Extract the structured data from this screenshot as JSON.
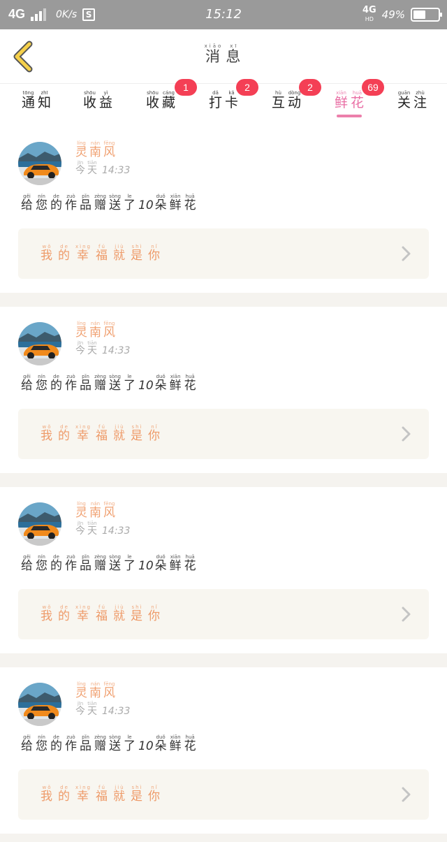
{
  "status_bar": {
    "network": "4G",
    "speed": "0K/s",
    "time": "15:12",
    "network_right": "4G",
    "network_right_sub": "HD",
    "battery_percent": "49%",
    "battery_level": 0.49
  },
  "header": {
    "title": [
      {
        "py": "xiāo",
        "ch": "消"
      },
      {
        "py": "xī",
        "ch": "息"
      }
    ]
  },
  "tabs": [
    {
      "label": [
        {
          "py": "tōng",
          "ch": "通"
        },
        {
          "py": "zhī",
          "ch": "知"
        }
      ],
      "badge": ""
    },
    {
      "label": [
        {
          "py": "shōu",
          "ch": "收"
        },
        {
          "py": "yì",
          "ch": "益"
        }
      ],
      "badge": ""
    },
    {
      "label": [
        {
          "py": "shōu",
          "ch": "收"
        },
        {
          "py": "cáng",
          "ch": "藏"
        }
      ],
      "badge": "1"
    },
    {
      "label": [
        {
          "py": "dǎ",
          "ch": "打"
        },
        {
          "py": "kǎ",
          "ch": "卡"
        }
      ],
      "badge": "2"
    },
    {
      "label": [
        {
          "py": "hù",
          "ch": "互"
        },
        {
          "py": "dòng",
          "ch": "动"
        }
      ],
      "badge": "2"
    },
    {
      "label": [
        {
          "py": "xiān",
          "ch": "鲜"
        },
        {
          "py": "huā",
          "ch": "花"
        }
      ],
      "badge": "69"
    },
    {
      "label": [
        {
          "py": "guān",
          "ch": "关"
        },
        {
          "py": "zhù",
          "ch": "注"
        }
      ],
      "badge": ""
    }
  ],
  "active_tab": 5,
  "messages": [
    {
      "user_name": [
        {
          "py": "líng",
          "ch": "灵"
        },
        {
          "py": "nán",
          "ch": "南"
        },
        {
          "py": "fēng",
          "ch": "风"
        }
      ],
      "date": [
        {
          "py": "jīn",
          "ch": "今"
        },
        {
          "py": "tiān",
          "ch": "天"
        }
      ],
      "time": "14:33",
      "text": [
        {
          "py": "gěi",
          "ch": "给"
        },
        {
          "py": "nín",
          "ch": "您"
        },
        {
          "py": "de",
          "ch": "的"
        },
        {
          "py": "zuò",
          "ch": "作"
        },
        {
          "py": "pǐn",
          "ch": "品"
        },
        {
          "py": "zèng",
          "ch": "赠"
        },
        {
          "py": "sòng",
          "ch": "送"
        },
        {
          "py": "le",
          "ch": "了"
        }
      ],
      "count": "10",
      "text_tail": [
        {
          "py": "duǒ",
          "ch": "朵"
        },
        {
          "py": "xiān",
          "ch": "鲜"
        },
        {
          "py": "huā",
          "ch": "花"
        }
      ],
      "work_title": [
        {
          "py": "wǒ",
          "ch": "我"
        },
        {
          "py": "de",
          "ch": "的"
        },
        {
          "py": "xìng",
          "ch": "幸"
        },
        {
          "py": "fú",
          "ch": "福"
        },
        {
          "py": "jiù",
          "ch": "就"
        },
        {
          "py": "shì",
          "ch": "是"
        },
        {
          "py": "nǐ",
          "ch": "你"
        }
      ]
    },
    {
      "user_name": [
        {
          "py": "líng",
          "ch": "灵"
        },
        {
          "py": "nán",
          "ch": "南"
        },
        {
          "py": "fēng",
          "ch": "风"
        }
      ],
      "date": [
        {
          "py": "jīn",
          "ch": "今"
        },
        {
          "py": "tiān",
          "ch": "天"
        }
      ],
      "time": "14:33",
      "text": [
        {
          "py": "gěi",
          "ch": "给"
        },
        {
          "py": "nín",
          "ch": "您"
        },
        {
          "py": "de",
          "ch": "的"
        },
        {
          "py": "zuò",
          "ch": "作"
        },
        {
          "py": "pǐn",
          "ch": "品"
        },
        {
          "py": "zèng",
          "ch": "赠"
        },
        {
          "py": "sòng",
          "ch": "送"
        },
        {
          "py": "le",
          "ch": "了"
        }
      ],
      "count": "10",
      "text_tail": [
        {
          "py": "duǒ",
          "ch": "朵"
        },
        {
          "py": "xiān",
          "ch": "鲜"
        },
        {
          "py": "huā",
          "ch": "花"
        }
      ],
      "work_title": [
        {
          "py": "wǒ",
          "ch": "我"
        },
        {
          "py": "de",
          "ch": "的"
        },
        {
          "py": "xìng",
          "ch": "幸"
        },
        {
          "py": "fú",
          "ch": "福"
        },
        {
          "py": "jiù",
          "ch": "就"
        },
        {
          "py": "shì",
          "ch": "是"
        },
        {
          "py": "nǐ",
          "ch": "你"
        }
      ]
    },
    {
      "user_name": [
        {
          "py": "líng",
          "ch": "灵"
        },
        {
          "py": "nán",
          "ch": "南"
        },
        {
          "py": "fēng",
          "ch": "风"
        }
      ],
      "date": [
        {
          "py": "jīn",
          "ch": "今"
        },
        {
          "py": "tiān",
          "ch": "天"
        }
      ],
      "time": "14:33",
      "text": [
        {
          "py": "gěi",
          "ch": "给"
        },
        {
          "py": "nín",
          "ch": "您"
        },
        {
          "py": "de",
          "ch": "的"
        },
        {
          "py": "zuò",
          "ch": "作"
        },
        {
          "py": "pǐn",
          "ch": "品"
        },
        {
          "py": "zèng",
          "ch": "赠"
        },
        {
          "py": "sòng",
          "ch": "送"
        },
        {
          "py": "le",
          "ch": "了"
        }
      ],
      "count": "10",
      "text_tail": [
        {
          "py": "duǒ",
          "ch": "朵"
        },
        {
          "py": "xiān",
          "ch": "鲜"
        },
        {
          "py": "huā",
          "ch": "花"
        }
      ],
      "work_title": [
        {
          "py": "wǒ",
          "ch": "我"
        },
        {
          "py": "de",
          "ch": "的"
        },
        {
          "py": "xìng",
          "ch": "幸"
        },
        {
          "py": "fú",
          "ch": "福"
        },
        {
          "py": "jiù",
          "ch": "就"
        },
        {
          "py": "shì",
          "ch": "是"
        },
        {
          "py": "nǐ",
          "ch": "你"
        }
      ]
    },
    {
      "user_name": [
        {
          "py": "líng",
          "ch": "灵"
        },
        {
          "py": "nán",
          "ch": "南"
        },
        {
          "py": "fēng",
          "ch": "风"
        }
      ],
      "date": [
        {
          "py": "jīn",
          "ch": "今"
        },
        {
          "py": "tiān",
          "ch": "天"
        }
      ],
      "time": "14:33",
      "text": [
        {
          "py": "gěi",
          "ch": "给"
        },
        {
          "py": "nín",
          "ch": "您"
        },
        {
          "py": "de",
          "ch": "的"
        },
        {
          "py": "zuò",
          "ch": "作"
        },
        {
          "py": "pǐn",
          "ch": "品"
        },
        {
          "py": "zèng",
          "ch": "赠"
        },
        {
          "py": "sòng",
          "ch": "送"
        },
        {
          "py": "le",
          "ch": "了"
        }
      ],
      "count": "10",
      "text_tail": [
        {
          "py": "duǒ",
          "ch": "朵"
        },
        {
          "py": "xiān",
          "ch": "鲜"
        },
        {
          "py": "huā",
          "ch": "花"
        }
      ],
      "work_title": [
        {
          "py": "wǒ",
          "ch": "我"
        },
        {
          "py": "de",
          "ch": "的"
        },
        {
          "py": "xìng",
          "ch": "幸"
        },
        {
          "py": "fú",
          "ch": "福"
        },
        {
          "py": "jiù",
          "ch": "就"
        },
        {
          "py": "shì",
          "ch": "是"
        },
        {
          "py": "nǐ",
          "ch": "你"
        }
      ]
    }
  ],
  "icons": {
    "back": "chevron-left-icon",
    "row_arrow": "chevron-right-icon",
    "avatar": "orange-sports-car-avatar"
  },
  "colors": {
    "active_tab": "#e96ea4",
    "badge": "#f43f55",
    "username": "#f0a070",
    "work_title": "#ee9a68",
    "back_icon": "#f5d04a"
  }
}
